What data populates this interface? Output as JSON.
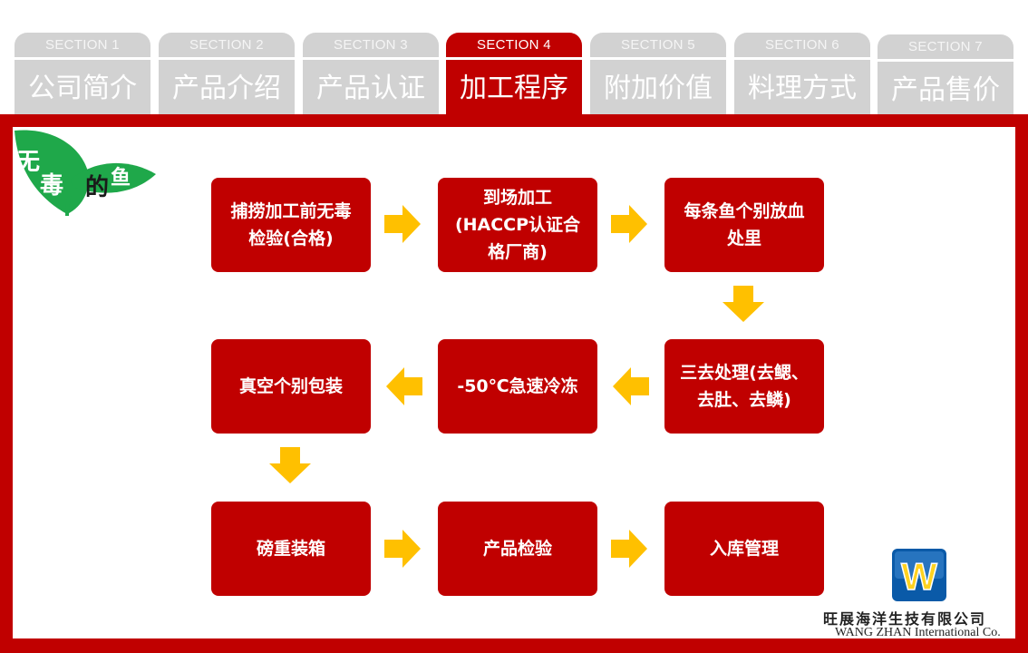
{
  "tabs": [
    {
      "section": "SECTION 1",
      "name": "公司简介",
      "active": false
    },
    {
      "section": "SECTION 2",
      "name": "产品介绍",
      "active": false
    },
    {
      "section": "SECTION 3",
      "name": "产品认证",
      "active": false
    },
    {
      "section": "SECTION 4",
      "name": "加工程序",
      "active": true
    },
    {
      "section": "SECTION 5",
      "name": "附加价值",
      "active": false
    },
    {
      "section": "SECTION 6",
      "name": "料理方式",
      "active": false
    },
    {
      "section": "SECTION 7",
      "name": "产品售价",
      "active": false
    }
  ],
  "logo": {
    "char1": "无",
    "char2": "毒",
    "char3": "的",
    "char4": "鱼"
  },
  "steps": [
    "捕捞加工前无毒\n检验(合格)",
    "到场加工\n(HACCP认证合\n格厂商)",
    "每条鱼个别放血\n处里",
    "三去处理(去鳃、\n去肚、去鳞)",
    "-50℃急速冷冻",
    "真空个别包装",
    "磅重装箱",
    "产品检验",
    "入库管理"
  ],
  "company": {
    "mark": "W",
    "name_cn": "旺展海洋生技有限公司",
    "name_en": "WANG ZHAN International Co."
  },
  "colors": {
    "accent": "#c00000",
    "tab_inactive": "#d2d2d2",
    "arrow": "#ffc000",
    "leaf": "#1fa84a"
  }
}
